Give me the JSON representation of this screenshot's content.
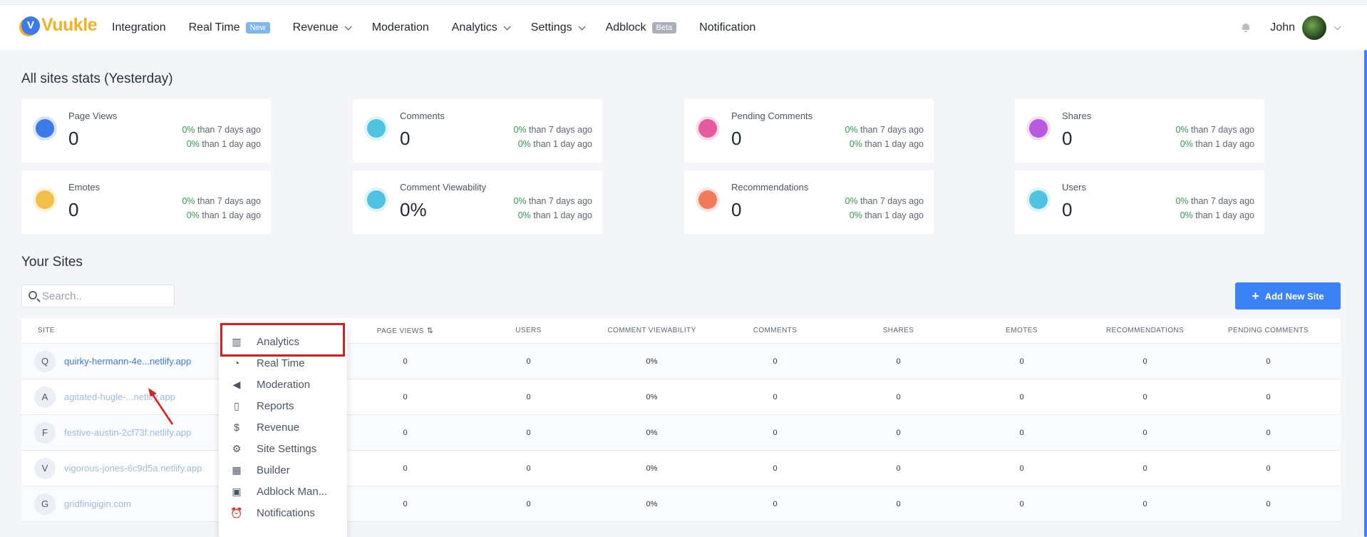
{
  "brand": {
    "badge": "V",
    "name": "Vuukle"
  },
  "nav": {
    "items": [
      {
        "label": "Integration",
        "tag": "",
        "dropdown": false
      },
      {
        "label": "Real Time",
        "tag": "New",
        "dropdown": false
      },
      {
        "label": "Revenue",
        "tag": "",
        "dropdown": true
      },
      {
        "label": "Moderation",
        "tag": "",
        "dropdown": false
      },
      {
        "label": "Analytics",
        "tag": "",
        "dropdown": true
      },
      {
        "label": "Settings",
        "tag": "",
        "dropdown": true
      },
      {
        "label": "Adblock",
        "tag": "Beta",
        "dropdown": false
      },
      {
        "label": "Notification",
        "tag": "",
        "dropdown": false
      }
    ],
    "user": "John"
  },
  "stats": {
    "title": "All sites stats (Yesterday)",
    "cards": [
      {
        "label": "Page Views",
        "value": "0",
        "pct7": "0%",
        "txt7": "than 7 days ago",
        "pct1": "0%",
        "txt1": "than 1 day ago",
        "icon": "eye-icon",
        "color": "#3b7ae8"
      },
      {
        "label": "Comments",
        "value": "0",
        "pct7": "0%",
        "txt7": "than 7 days ago",
        "pct1": "0%",
        "txt1": "than 1 day ago",
        "icon": "comments-icon",
        "color": "#4fc3e0"
      },
      {
        "label": "Pending Comments",
        "value": "0",
        "pct7": "0%",
        "txt7": "than 7 days ago",
        "pct1": "0%",
        "txt1": "than 1 day ago",
        "icon": "hourglass-icon",
        "color": "#e65a9e"
      },
      {
        "label": "Shares",
        "value": "0",
        "pct7": "0%",
        "txt7": "than 7 days ago",
        "pct1": "0%",
        "txt1": "than 1 day ago",
        "icon": "share-icon",
        "color": "#b85ae0"
      },
      {
        "label": "Emotes",
        "value": "0",
        "pct7": "0%",
        "txt7": "than 7 days ago",
        "pct1": "0%",
        "txt1": "than 1 day ago",
        "icon": "smile-icon",
        "color": "#f2bf4a"
      },
      {
        "label": "Comment Viewability",
        "value": "0%",
        "pct7": "0%",
        "txt7": "than 7 days ago",
        "pct1": "0%",
        "txt1": "than 1 day ago",
        "icon": "viewability-icon",
        "color": "#4fc3e0"
      },
      {
        "label": "Recommendations",
        "value": "0",
        "pct7": "0%",
        "txt7": "than 7 days ago",
        "pct1": "0%",
        "txt1": "than 1 day ago",
        "icon": "heart-icon",
        "color": "#f07a5a"
      },
      {
        "label": "Users",
        "value": "0",
        "pct7": "0%",
        "txt7": "than 7 days ago",
        "pct1": "0%",
        "txt1": "than 1 day ago",
        "icon": "user-icon",
        "color": "#4fc3e0"
      }
    ]
  },
  "sites": {
    "title": "Your Sites",
    "search_placeholder": "Search..",
    "add_label": "Add New Site",
    "columns": [
      "Site",
      "Page Views",
      "Users",
      "Comment Viewability",
      "Comments",
      "Shares",
      "Emotes",
      "Recommendations",
      "Pending Comments"
    ],
    "rows": [
      {
        "letter": "Q",
        "name": "quirky-hermann-4e...netlify.app",
        "values": [
          "0",
          "0",
          "0%",
          "0",
          "0",
          "0",
          "0",
          "0"
        ]
      },
      {
        "letter": "A",
        "name": "agitated-hugle-...netlify.app",
        "values": [
          "0",
          "0",
          "0%",
          "0",
          "0",
          "0",
          "0",
          "0"
        ]
      },
      {
        "letter": "F",
        "name": "festive-austin-2cf73f.netlify.app",
        "values": [
          "0",
          "0",
          "0%",
          "0",
          "0",
          "0",
          "0",
          "0"
        ]
      },
      {
        "letter": "V",
        "name": "vigorous-jones-6c9d5a.netlify.app",
        "values": [
          "0",
          "0",
          "0%",
          "0",
          "0",
          "0",
          "0",
          "0"
        ]
      },
      {
        "letter": "G",
        "name": "gridfinigigin.com",
        "values": [
          "0",
          "0",
          "0%",
          "0",
          "0",
          "0",
          "0",
          "0"
        ]
      }
    ]
  },
  "menu": {
    "items": [
      {
        "label": "Analytics",
        "icon": "chart-icon"
      },
      {
        "label": "Real Time",
        "icon": "clock-icon"
      },
      {
        "label": "Moderation",
        "icon": "megaphone-icon"
      },
      {
        "label": "Reports",
        "icon": "book-icon"
      },
      {
        "label": "Revenue",
        "icon": "dollar-icon"
      },
      {
        "label": "Site Settings",
        "icon": "gear-icon"
      },
      {
        "label": "Builder",
        "icon": "builder-icon"
      },
      {
        "label": "Adblock Man...",
        "icon": "ad-icon"
      },
      {
        "label": "Notifications",
        "icon": "alarm-icon"
      }
    ]
  }
}
